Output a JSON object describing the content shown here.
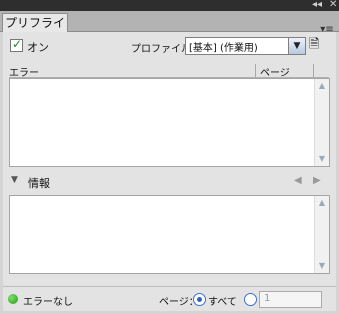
{
  "panel": {
    "tab_label": "プリフライト",
    "collapse_icon": "double-chevron-left-icon",
    "close_icon": "close-icon",
    "menu_icon": "panel-menu-icon"
  },
  "toolbar": {
    "on_label": "オン",
    "on_checked": true,
    "profile_label": "プロファイル：",
    "profile_value": "[基本] (作業用)"
  },
  "errors": {
    "columns": [
      "エラー",
      "ページ"
    ]
  },
  "info": {
    "label": "情報"
  },
  "status": {
    "text": "エラーなし",
    "page_label": "ページ：",
    "all_label": "すべて",
    "range_value": "1"
  },
  "colors": {
    "title_bg": "#2e2e2e",
    "panel_bg": "#e3e3e3",
    "status_ok": "#1f9a12",
    "radio_accent": "#2d62c8"
  }
}
